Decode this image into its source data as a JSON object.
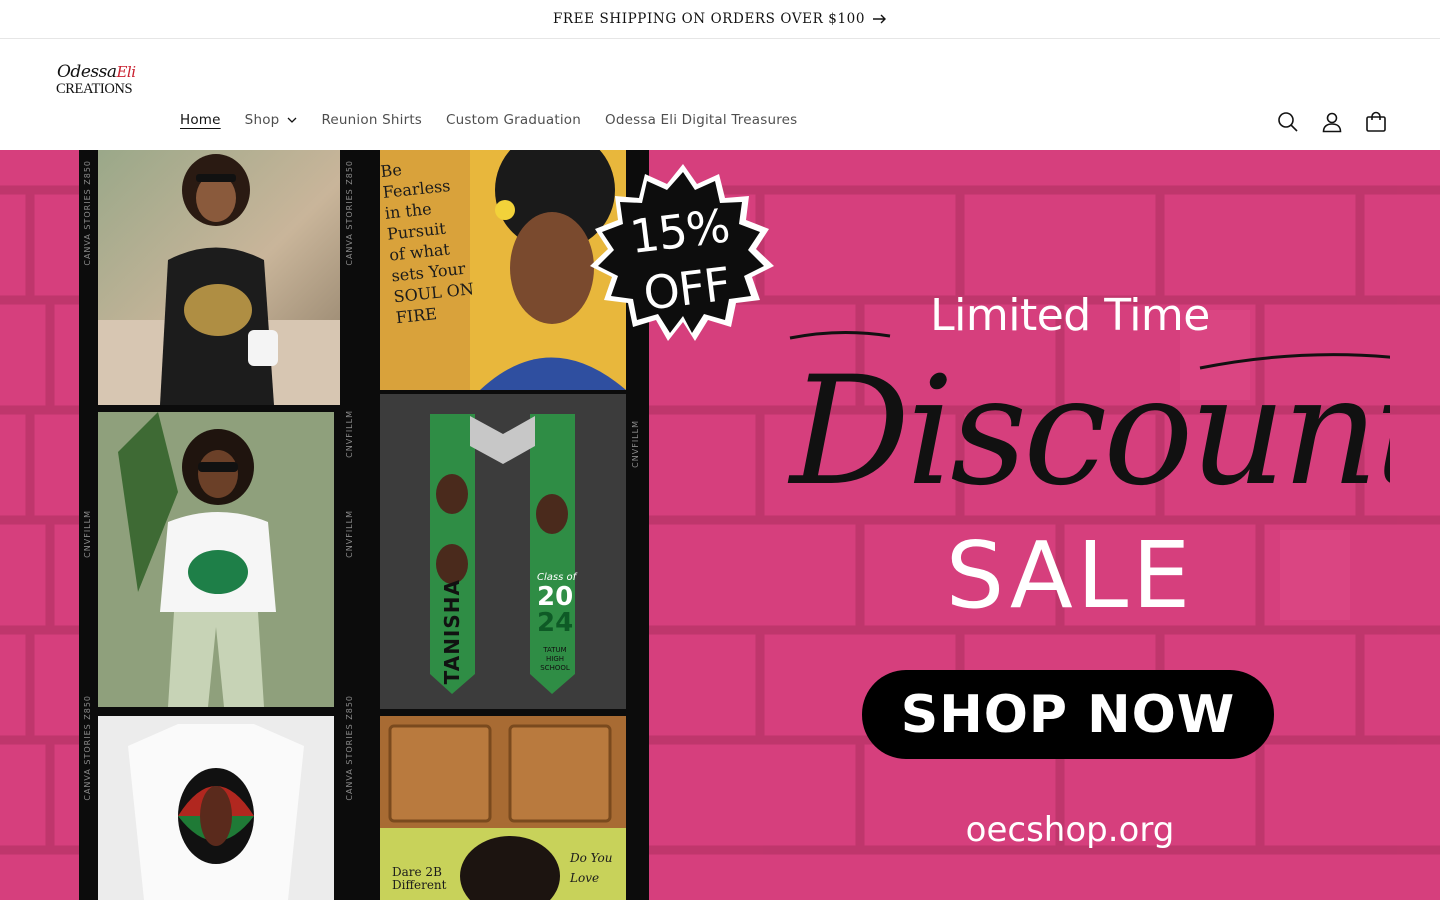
{
  "announcement": {
    "text": "FREE SHIPPING ON ORDERS OVER $100"
  },
  "logo": {
    "script": "Odessa",
    "script_accent": "Eli",
    "word": "CREATIONS"
  },
  "nav": {
    "home": "Home",
    "shop": "Shop",
    "reunion": "Reunion Shirts",
    "graduation": "Custom Graduation",
    "digital": "Odessa Eli Digital Treasures"
  },
  "hero": {
    "badge_line1": "15%",
    "badge_line2": "OFF",
    "limited": "Limited Time",
    "discount": "Discount",
    "sale": "SALE",
    "cta": "SHOP NOW",
    "site": "oecshop.org",
    "poster_text": [
      "Be",
      "Fearless",
      "in the",
      "Pursuit",
      "of what",
      "sets Your",
      "SOUL ON",
      "FIRE"
    ],
    "stole_name": "TANISHA",
    "stole_year_1": "20",
    "stole_year_2": "24",
    "stole_class": "Class of",
    "stole_school": "TATUM HIGH SCHOOL",
    "poster2_left": "Dare 2B Different",
    "poster2_right": "Do You Love",
    "film_edge_1": "CANVA STORIES Z850",
    "film_edge_2": "CNVFILLM"
  },
  "colors": {
    "hero_bg": "#d63f7d",
    "brick_line": "#a82a5c",
    "logo_accent": "#c9202f"
  }
}
